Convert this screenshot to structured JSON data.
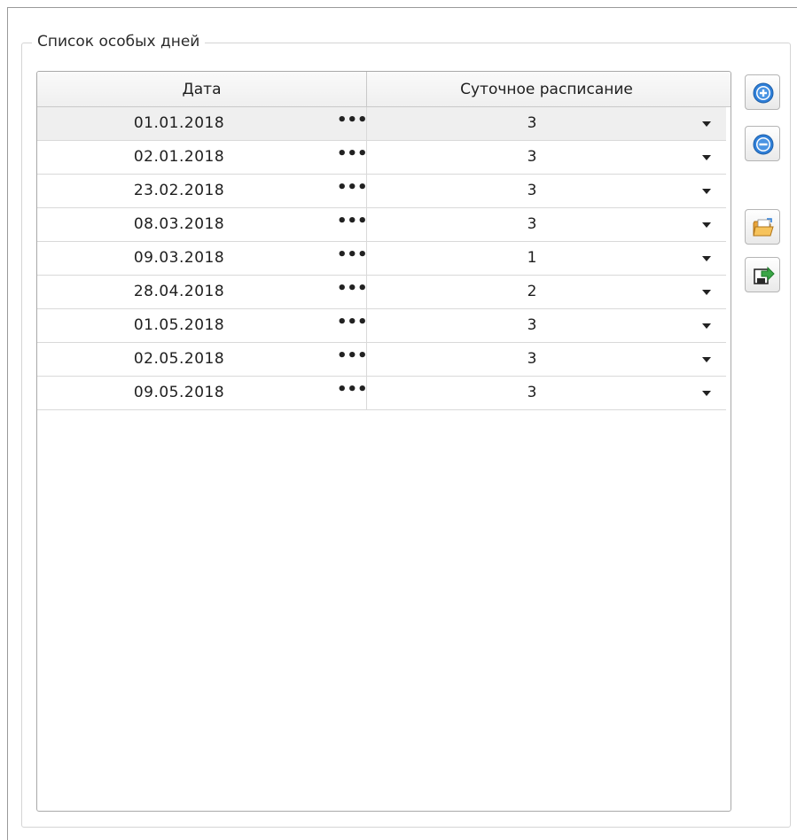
{
  "group": {
    "title": "Список особых дней"
  },
  "table": {
    "columns": {
      "date": "Дата",
      "schedule": "Суточное расписание"
    },
    "ellipsis_glyph": "•••",
    "rows": [
      {
        "date": "01.01.2018",
        "schedule": "3",
        "selected": true
      },
      {
        "date": "02.01.2018",
        "schedule": "3"
      },
      {
        "date": "23.02.2018",
        "schedule": "3"
      },
      {
        "date": "08.03.2018",
        "schedule": "3"
      },
      {
        "date": "09.03.2018",
        "schedule": "1"
      },
      {
        "date": "28.04.2018",
        "schedule": "2"
      },
      {
        "date": "01.05.2018",
        "schedule": "3"
      },
      {
        "date": "02.05.2018",
        "schedule": "3"
      },
      {
        "date": "09.05.2018",
        "schedule": "3"
      }
    ]
  },
  "toolbar": {
    "buttons": [
      {
        "icon": "add-circle-icon"
      },
      {
        "icon": "remove-circle-icon"
      },
      {
        "icon": "open-folder-icon"
      },
      {
        "icon": "export-icon"
      }
    ]
  },
  "colors": {
    "accent_blue": "#2f7fd8",
    "folder_orange": "#e8a33a",
    "export_green": "#3aa646",
    "selected_row": "#efefef"
  }
}
